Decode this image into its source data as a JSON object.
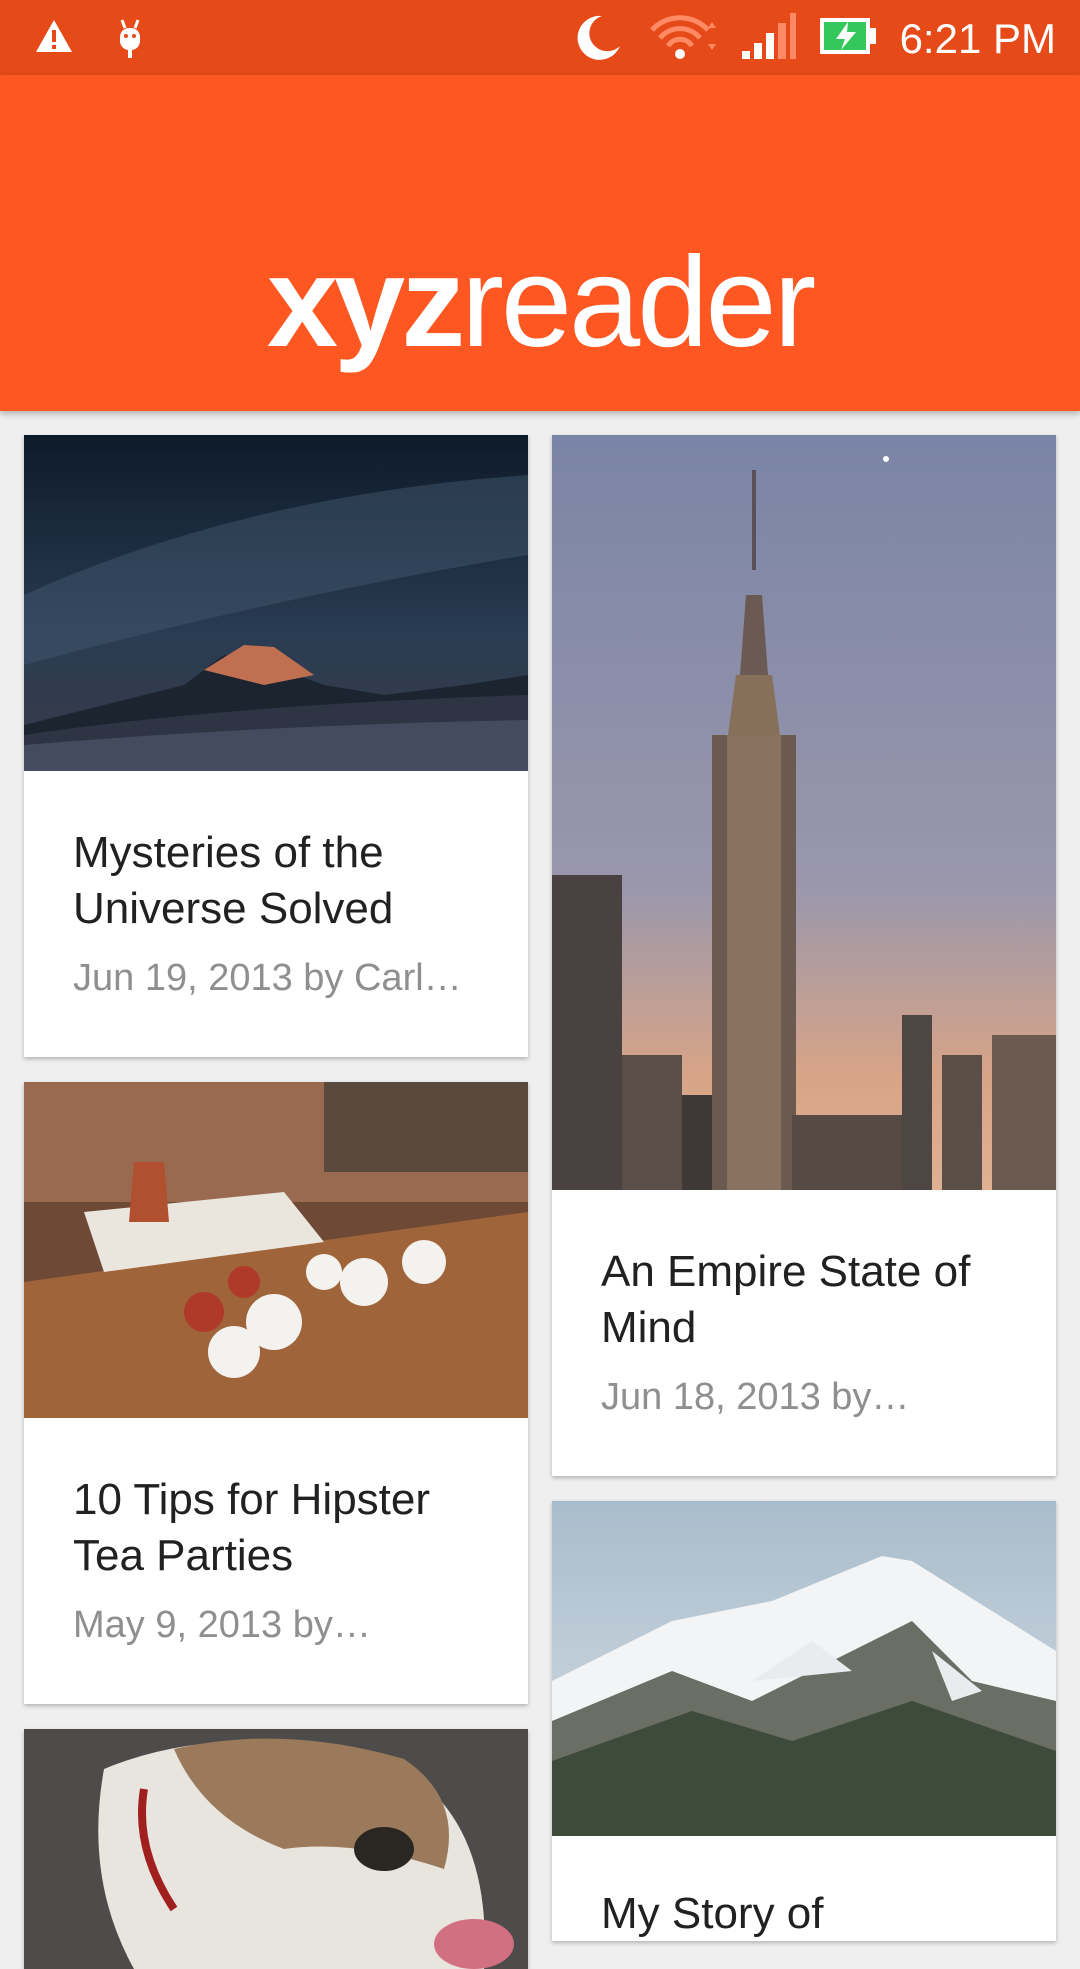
{
  "status_bar": {
    "time": "6:21 PM",
    "icons": [
      "warning-icon",
      "android-debug-icon",
      "do-not-disturb-moon-icon",
      "wifi-icon",
      "cell-signal-icon",
      "battery-charging-icon"
    ]
  },
  "app_bar": {
    "logo_bold": "xyz",
    "logo_light": "reader",
    "color": "#ff5722",
    "status_color": "#e64a19"
  },
  "articles": [
    {
      "title": "Mysteries of the Universe Solved",
      "meta": "Jun 19, 2013 by Carl…",
      "image": "night-sky-mountain-photo"
    },
    {
      "title": "An Empire State of Mind",
      "meta": "Jun 18, 2013 by…",
      "image": "empire-state-building-photo"
    },
    {
      "title": "10 Tips for Hipster Tea Parties",
      "meta": "May 9, 2013 by…",
      "image": "tea-cups-table-photo"
    },
    {
      "title": "My Story of",
      "meta": "",
      "image": "snowy-mountain-photo"
    },
    {
      "title": "",
      "meta": "",
      "image": "bulldog-photo"
    }
  ]
}
